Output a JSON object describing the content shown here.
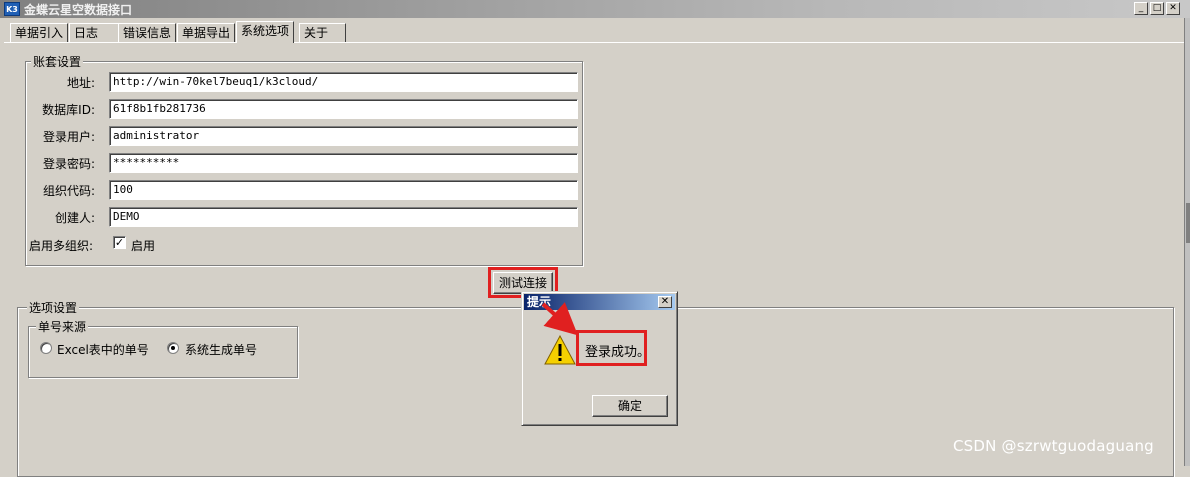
{
  "window": {
    "title": "金蝶云星空数据接口",
    "icon": "K3",
    "controls": [
      "minimize-icon",
      "maximize-icon",
      "close-icon"
    ]
  },
  "tabs": [
    {
      "label": "单据引入",
      "active": false
    },
    {
      "label": "日志",
      "active": false
    },
    {
      "label": "错误信息",
      "active": false
    },
    {
      "label": "单据导出",
      "active": false
    },
    {
      "label": "系统选项",
      "active": true
    },
    {
      "label": "关于",
      "active": false
    }
  ],
  "account": {
    "group_title": "账套设置",
    "fields": [
      {
        "label": "地址:",
        "value": "http://win-70kel7beuq1/k3cloud/"
      },
      {
        "label": "数据库ID:",
        "value": "61f8b1fb281736"
      },
      {
        "label": "登录用户:",
        "value": "administrator"
      },
      {
        "label": "登录密码:",
        "value": "**********"
      },
      {
        "label": "组织代码:",
        "value": "100"
      },
      {
        "label": "创建人:",
        "value": "DEMO"
      }
    ],
    "multi_org": {
      "label": "启用多组织:",
      "checkbox_label": "启用",
      "checked": true
    },
    "test_button": "测试连接"
  },
  "options": {
    "group_title": "选项设置",
    "number_source": {
      "title": "单号来源",
      "choices": [
        {
          "label": "Excel表中的单号",
          "selected": false
        },
        {
          "label": "系统生成单号",
          "selected": true
        }
      ]
    }
  },
  "dialog": {
    "title": "提示",
    "icon": "warning-icon",
    "message": "登录成功。",
    "ok_button": "确定"
  },
  "watermark": "CSDN @szrwtguodaguang",
  "colors": {
    "annotation": "#e02020",
    "dialog_title": "#0a246a"
  }
}
